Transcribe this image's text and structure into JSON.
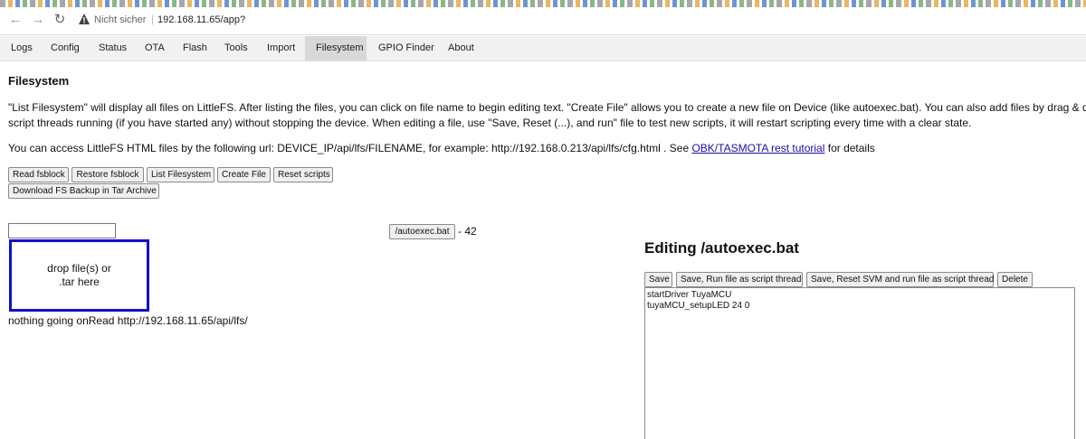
{
  "browser": {
    "security_label": "Nicht sicher",
    "separator": "|",
    "url": "192.168.11.65/app?"
  },
  "tabs": [
    {
      "label": "Logs",
      "active": false
    },
    {
      "label": "Config",
      "active": false
    },
    {
      "label": "Status",
      "active": false
    },
    {
      "label": "OTA",
      "active": false
    },
    {
      "label": "Flash",
      "active": false
    },
    {
      "label": "Tools",
      "active": false
    },
    {
      "label": "Import",
      "active": false
    },
    {
      "label": "Filesystem",
      "active": true
    },
    {
      "label": "GPIO Finder",
      "active": false
    },
    {
      "label": "About",
      "active": false
    }
  ],
  "page": {
    "title": "Filesystem",
    "description_line1": "\"List Filesystem\" will display all files on LittleFS. After listing the files, you can click on file name to begin editing text. \"Create File\" allows you to create a new file on Device (like autoexec.bat). You can also add files by drag & drop",
    "description_line2": "script threads running (if you have started any) without stopping the device. When editing a file, use \"Save, Reset (...), and run\" file to test new scripts, it will restart scripting every time with a clear state.",
    "access_prefix": "You can access LittleFS HTML files by the following url: DEVICE_IP/api/lfs/FILENAME, for example: http://192.168.0.213/api/lfs/cfg.html . See ",
    "access_link": "OBK/TASMOTA rest tutorial",
    "access_suffix": " for details"
  },
  "toolbar": {
    "read_fsblock": "Read fsblock",
    "restore_fsblock": "Restore fsblock",
    "list_filesystem": "List Filesystem",
    "create_file": "Create File",
    "reset_scripts": "Reset scripts",
    "download_backup": "Download FS Backup in Tar Archive"
  },
  "files": {
    "filename_value": "",
    "dropzone_line1": "drop file(s) or",
    "dropzone_line2": ".tar here",
    "status": "nothing going onRead http://192.168.11.65/api/lfs/",
    "entries": [
      {
        "name": "/autoexec.bat",
        "size_text": " - 42"
      }
    ]
  },
  "editor": {
    "title": "Editing /autoexec.bat",
    "save": "Save",
    "save_run": "Save, Run file as script thread",
    "save_reset_run": "Save, Reset SVM and run file as script thread",
    "delete": "Delete",
    "content": "startDriver TuyaMCU\ntuyaMCU_setupLED 24 0"
  },
  "colors": {
    "dropzone_border": "#1010c8",
    "link": "#1a0dab",
    "active_tab": "#d8d8d8"
  }
}
